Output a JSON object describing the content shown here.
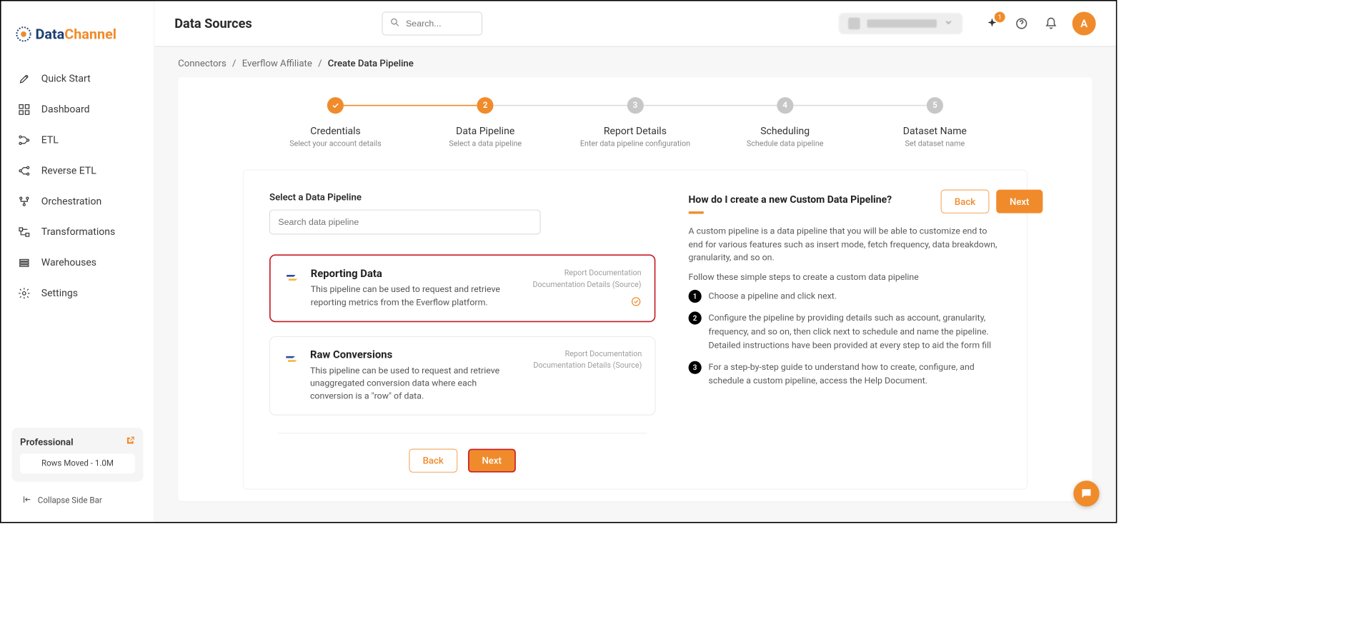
{
  "brand": {
    "part1": "Data",
    "part2": "Channel"
  },
  "sidebar": {
    "items": [
      {
        "label": "Quick Start"
      },
      {
        "label": "Dashboard"
      },
      {
        "label": "ETL"
      },
      {
        "label": "Reverse ETL"
      },
      {
        "label": "Orchestration"
      },
      {
        "label": "Transformations"
      },
      {
        "label": "Warehouses"
      },
      {
        "label": "Settings"
      }
    ],
    "plan": {
      "name": "Professional",
      "stat": "Rows Moved - 1.0M"
    },
    "collapse": "Collapse Side Bar"
  },
  "header": {
    "title": "Data Sources",
    "search_placeholder": "Search...",
    "avatar": "A",
    "notif_badge": "1"
  },
  "breadcrumb": {
    "a": "Connectors",
    "b": "Everflow Affiliate",
    "c": "Create Data Pipeline"
  },
  "stepper": [
    {
      "title": "Credentials",
      "sub": "Select your account details"
    },
    {
      "title": "Data Pipeline",
      "sub": "Select a data pipeline"
    },
    {
      "title": "Report Details",
      "sub": "Enter data pipeline configuration"
    },
    {
      "title": "Scheduling",
      "sub": "Schedule data pipeline"
    },
    {
      "title": "Dataset Name",
      "sub": "Set dataset name"
    }
  ],
  "pipeline": {
    "section_label": "Select a Data Pipeline",
    "search_placeholder": "Search data pipeline",
    "back": "Back",
    "next": "Next",
    "cards": [
      {
        "title": "Reporting Data",
        "desc": "This pipeline can be used to request and retrieve reporting metrics from the Everflow platform.",
        "doc1": "Report Documentation",
        "doc2": "Documentation Details (Source)"
      },
      {
        "title": "Raw Conversions",
        "desc": "This pipeline can be used to request and retrieve unaggregated conversion data where each conversion is a \"row\" of data.",
        "doc1": "Report Documentation",
        "doc2": "Documentation Details (Source)"
      }
    ]
  },
  "help": {
    "title": "How do I create a new Custom Data Pipeline?",
    "p1": "A custom pipeline is a data pipeline that you will be able to customize end to end for various features such as insert mode, fetch frequency, data breakdown, granularity, and so on.",
    "p2": "Follow these simple steps to create a custom data pipeline",
    "steps": [
      "Choose a pipeline and click next.",
      "Configure the pipeline by providing details such as account, granularity, frequency, and so on, then click next to schedule and name the pipeline. Detailed instructions have been provided at every step to aid the form fill",
      "For a step-by-step guide to understand how to create, configure, and schedule a custom pipeline, access the Help Document."
    ]
  }
}
